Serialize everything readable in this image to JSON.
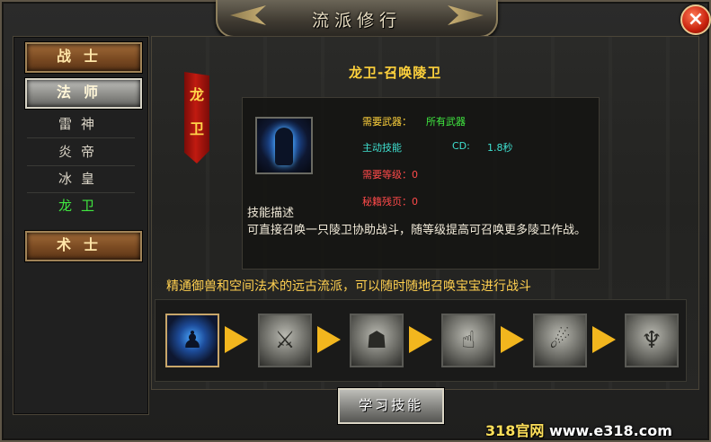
{
  "window": {
    "title": "流派修行",
    "close_glyph": "×"
  },
  "classes": {
    "warrior": "战士",
    "mage": "法师",
    "taoist": "术士",
    "mage_subs": [
      {
        "label": "雷神",
        "active": false
      },
      {
        "label": "炎帝",
        "active": false
      },
      {
        "label": "冰皇",
        "active": false
      },
      {
        "label": "龙卫",
        "active": true
      }
    ]
  },
  "banner": {
    "text_top": "龙",
    "text_bottom": "卫"
  },
  "skill": {
    "title": "龙卫-召唤陵卫",
    "weapon_label": "需要武器：",
    "weapon_value": "所有武器",
    "active_label": "主动技能",
    "cd_label": "CD:",
    "cd_value": "1.8秒",
    "level_req": "需要等级：0",
    "scroll_req": "秘籍残页：0",
    "desc_title": "技能描述",
    "desc_text": "可直接召唤一只陵卫协助战斗，随等级提高可召唤更多陵卫作战。",
    "icon": "dragon-guardian-icon"
  },
  "flavor_text": "精通御兽和空间法术的远古流派，可以随时随地召唤宝宝进行战斗",
  "skill_chain": [
    {
      "icon": "summon-guardian-icon",
      "active": true
    },
    {
      "icon": "claw-strike-icon",
      "active": false
    },
    {
      "icon": "beast-face-icon",
      "active": false
    },
    {
      "icon": "praying-hands-icon",
      "active": false
    },
    {
      "icon": "dash-figure-icon",
      "active": false
    },
    {
      "icon": "wing-spirit-icon",
      "active": false
    }
  ],
  "learn_button": "学习技能",
  "watermark": {
    "part1": "318官网",
    "part2": "www.e318.com"
  },
  "colors": {
    "gold": "#ffd23c",
    "green": "#40e840",
    "red": "#ff4a4a",
    "cyan": "#3fe0d0",
    "arrow": "#f2b61e"
  }
}
